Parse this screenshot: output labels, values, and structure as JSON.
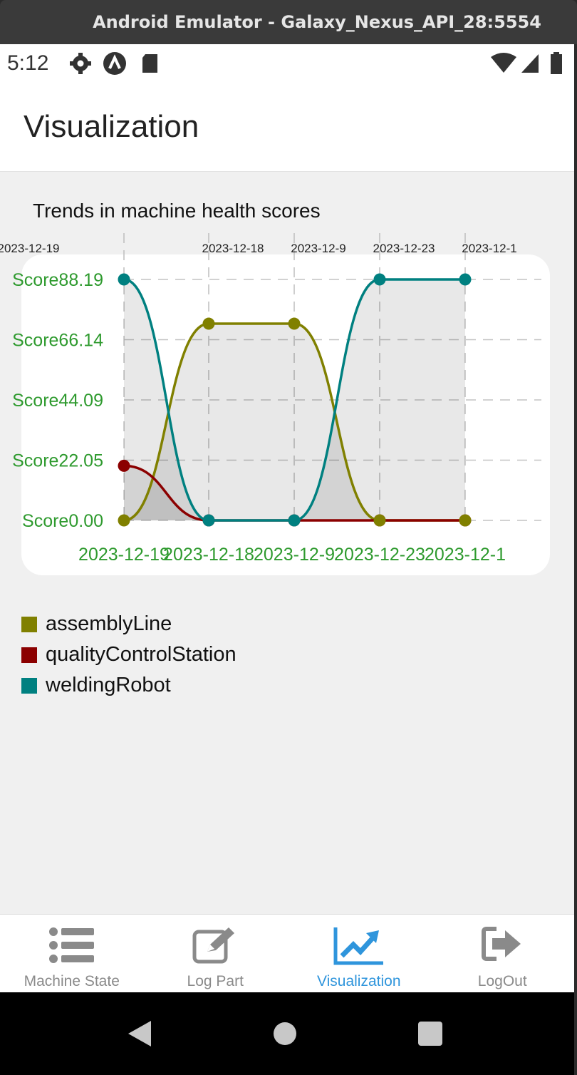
{
  "window": {
    "title": "Android Emulator - Galaxy_Nexus_API_28:5554"
  },
  "status_bar": {
    "time": "5:12",
    "icons": [
      "gear-icon",
      "app-logo-icon",
      "sd-card-icon",
      "wifi-icon",
      "signal-icon",
      "battery-icon"
    ]
  },
  "header": {
    "title": "Visualization"
  },
  "chart_data": {
    "type": "area",
    "title": "Trends in machine health scores",
    "categories": [
      "2023-12-19",
      "2023-12-18",
      "2023-12-9",
      "2023-12-23",
      "2023-12-1"
    ],
    "top_axis_labels": [
      "2023-12-19",
      "2023-12-18",
      "2023-12-9",
      "2023-12-23",
      "2023-12-1"
    ],
    "y_tick_labels": [
      "Score88.19",
      "Score66.14",
      "Score44.09",
      "Score22.05",
      "Score0.00"
    ],
    "y_ticks": [
      88.19,
      66.14,
      44.09,
      22.05,
      0.0
    ],
    "ylim": [
      0,
      88.19
    ],
    "grid": true,
    "legend_position": "bottom-left",
    "series": [
      {
        "name": "assemblyLine",
        "color": "#808000",
        "values": [
          0,
          72,
          72,
          0,
          0
        ]
      },
      {
        "name": "qualityControlStation",
        "color": "#8b0000",
        "values": [
          20,
          0,
          0,
          0,
          0
        ]
      },
      {
        "name": "weldingRobot",
        "color": "#008080",
        "values": [
          88.19,
          0,
          0,
          88.19,
          88.19
        ]
      }
    ]
  },
  "legend": [
    {
      "label": "assemblyLine",
      "color": "#808000"
    },
    {
      "label": "qualityControlStation",
      "color": "#8b0000"
    },
    {
      "label": "weldingRobot",
      "color": "#008080"
    }
  ],
  "tabs": [
    {
      "label": "Machine State",
      "icon": "list-icon",
      "active": false
    },
    {
      "label": "Log Part",
      "icon": "edit-icon",
      "active": false
    },
    {
      "label": "Visualization",
      "icon": "trend-chart-icon",
      "active": true
    },
    {
      "label": "LogOut",
      "icon": "logout-icon",
      "active": false
    }
  ],
  "nav": {
    "icons": [
      "back-icon",
      "home-icon",
      "recents-icon"
    ]
  }
}
